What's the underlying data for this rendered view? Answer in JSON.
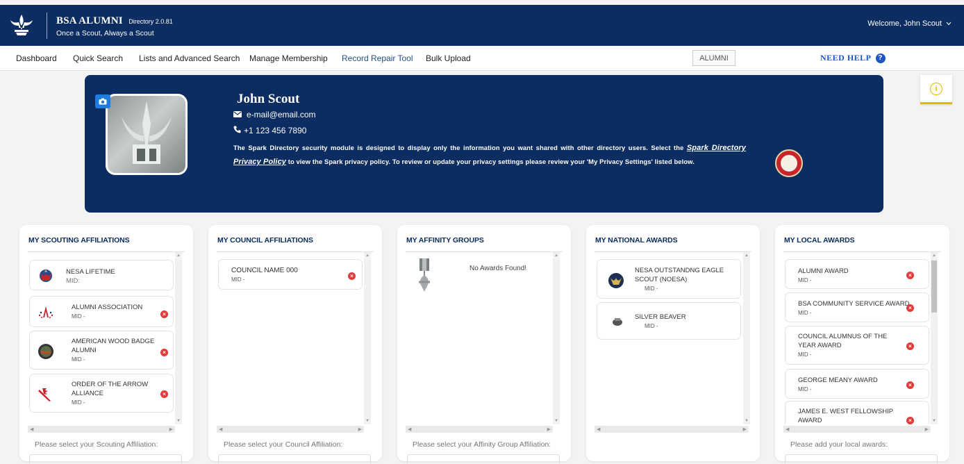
{
  "header": {
    "app_name": "BSA ALUMNI",
    "version": "Directory 2.0.81",
    "tagline": "Once a Scout, Always a Scout",
    "welcome": "Welcome, John Scout"
  },
  "nav": {
    "items": [
      {
        "label": "Dashboard"
      },
      {
        "label": "Quick Search"
      },
      {
        "label": "Lists and Advanced Search"
      },
      {
        "label": "Manage Membership"
      },
      {
        "label": "Record Repair Tool"
      },
      {
        "label": "Bulk Upload"
      }
    ],
    "mode_button": "ALUMNI",
    "need_help": "NEED HELP"
  },
  "profile": {
    "name": "John Scout",
    "email": "e-mail@email.com",
    "phone": "+1 123 456 7890",
    "desc_before": "The Spark Directory security module is designed to display only the information you want shared with other directory users. Select the ",
    "policy_link": "Spark Directory Privacy Policy",
    "desc_after": " to view the Spark privacy policy. To review or update your privacy settings please review your 'My Privacy Settings' listed below."
  },
  "cards": {
    "scouting": {
      "title": "MY SCOUTING AFFILIATIONS",
      "items": [
        {
          "name": "NESA LIFETIME",
          "mid": "MID:"
        },
        {
          "name": "ALUMNI ASSOCIATION",
          "mid": "MID -"
        },
        {
          "name": "AMERICAN WOOD BADGE ALUMNI",
          "mid": "MID -"
        },
        {
          "name": "ORDER OF THE ARROW ALLIANCE",
          "mid": "MID -"
        }
      ],
      "select_label": "Please select your Scouting Affiliation:"
    },
    "council": {
      "title": "MY COUNCIL AFFILIATIONS",
      "items": [
        {
          "name": "COUNCIL NAME 000",
          "mid": "MID -"
        }
      ],
      "select_label": "Please select your Council Affiliation:"
    },
    "affinity": {
      "title": "MY AFFINITY GROUPS",
      "empty": "No Awards Found!",
      "select_label": "Please select your Affinity Group Affiliation:"
    },
    "national": {
      "title": "MY NATIONAL AWARDS",
      "items": [
        {
          "name": "NESA OUTSTANDNG EAGLE SCOUT (NOESA)",
          "mid": "MID -"
        },
        {
          "name": "SILVER BEAVER",
          "mid": "MID -"
        }
      ]
    },
    "local": {
      "title": "MY LOCAL AWARDS",
      "items": [
        {
          "name": "ALUMNI AWARD",
          "mid": "MID -"
        },
        {
          "name": "BSA COMMUNITY SERVICE AWARD",
          "mid": "MID -"
        },
        {
          "name": "COUNCIL ALUMNUS OF THE YEAR AWARD",
          "mid": "MID -"
        },
        {
          "name": "GEORGE MEANY AWARD",
          "mid": "MID -"
        },
        {
          "name": "JAMES E. WEST FELLOWSHIP AWARD",
          "mid": ""
        }
      ],
      "select_label": "Please add your local awards:"
    }
  },
  "colors": {
    "navy": "#0b2d61",
    "accent_blue": "#1f56c4",
    "remove_red": "#e53a3a",
    "info_yellow": "#f0b400"
  }
}
